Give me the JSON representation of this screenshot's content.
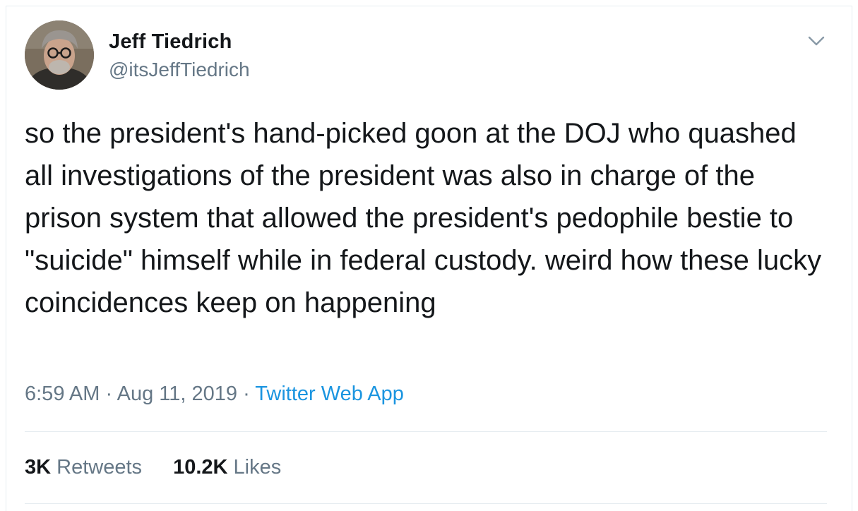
{
  "tweet": {
    "author_name": "Jeff Tiedrich",
    "author_handle": "@itsJeffTiedrich",
    "text": "so the president's hand-picked goon at the DOJ who quashed all investigations of the president was also in charge of the prison system that allowed the president's pedophile bestie to \"suicide\" himself while in federal custody. weird how these lucky coincidences keep on happening",
    "time": "6:59 AM",
    "separator": "·",
    "date": "Aug 11, 2019",
    "source": "Twitter Web App"
  },
  "stats": {
    "retweets_count": "3K",
    "retweets_label": "Retweets",
    "likes_count": "10.2K",
    "likes_label": "Likes"
  },
  "icons": {
    "more": "chevron-down-icon",
    "avatar": "avatar"
  },
  "colors": {
    "text": "#14171a",
    "secondary": "#657786",
    "link": "#1b95e0",
    "border": "#e6ecf0"
  }
}
